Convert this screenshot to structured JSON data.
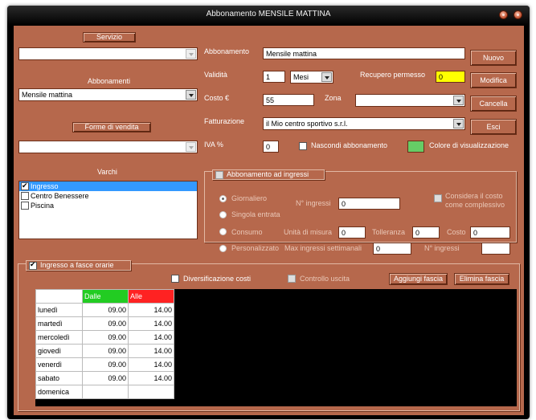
{
  "window": {
    "title": "Abbonamento MENSILE MATTINA"
  },
  "left": {
    "servizio_label": "Servizio",
    "servizio_value": "",
    "abbonamenti_label": "Abbonamenti",
    "abbonamenti_value": "Mensile mattina",
    "forme_label": "Forme di vendita",
    "forme_value": "",
    "varchi_label": "Varchi",
    "varchi": [
      {
        "label": "Ingresso",
        "checked": true,
        "selected": true
      },
      {
        "label": "Centro Benessere",
        "checked": false,
        "selected": false
      },
      {
        "label": "Piscina",
        "checked": false,
        "selected": false
      }
    ]
  },
  "form": {
    "abbonamento_label": "Abbonamento",
    "abbonamento_value": "Mensile mattina",
    "validita_label": "Validità",
    "validita_value": "1",
    "validita_unit": "Mesi",
    "recupero_label": "Recupero permesso",
    "recupero_value": "0",
    "costo_label": "Costo €",
    "costo_value": "55",
    "zona_label": "Zona",
    "zona_value": "",
    "fatturazione_label": "Fatturazione",
    "fatturazione_value": "il Mio centro sportivo s.r.l.",
    "iva_label": "IVA %",
    "iva_value": "0",
    "nascondi_label": "Nascondi abbonamento",
    "colore_label": "Colore di visualizzazione",
    "colore_hex": "#66cc66"
  },
  "buttons": {
    "nuovo": "Nuovo",
    "modifica": "Modifica",
    "cancella": "Cancella",
    "esci": "Esci"
  },
  "ingressi": {
    "title": "Abbonamento ad ingressi",
    "giornaliero": "Giornaliero",
    "n_ingressi_label": "N° ingressi",
    "n_ingressi_value": "0",
    "considera_line1": "Considera il costo",
    "considera_line2": "come complessivo",
    "singola": "Singola entrata",
    "consumo": "Consumo",
    "unita_label": "Unità di misura",
    "unita_value": "0",
    "tolleranza_label": "Tolleranza",
    "tolleranza_value": "0",
    "costo_label": "Costo",
    "costo_value": "0",
    "personalizzato": "Personalizzato",
    "max_label": "Max ingressi settimanali",
    "max_value": "0",
    "n_ingressi2_label": "N° ingressi",
    "n_ingressi2_value": ""
  },
  "fasce": {
    "title": "Ingresso a fasce orarie",
    "diversificazione": "Diversificazione costi",
    "controllo": "Controllo uscita",
    "aggiungi": "Aggiungi fascia",
    "elimina": "Elimina fascia",
    "col_dalle": "Dalle",
    "col_alle": "Alle",
    "rows": [
      {
        "day": "lunedì",
        "dalle": "09.00",
        "alle": "14.00"
      },
      {
        "day": "martedì",
        "dalle": "09.00",
        "alle": "14.00"
      },
      {
        "day": "mercoledì",
        "dalle": "09.00",
        "alle": "14.00"
      },
      {
        "day": "giovedì",
        "dalle": "09.00",
        "alle": "14.00"
      },
      {
        "day": "venerdì",
        "dalle": "09.00",
        "alle": "14.00"
      },
      {
        "day": "sabato",
        "dalle": "09.00",
        "alle": "14.00"
      },
      {
        "day": "domenica",
        "dalle": "",
        "alle": ""
      }
    ]
  }
}
